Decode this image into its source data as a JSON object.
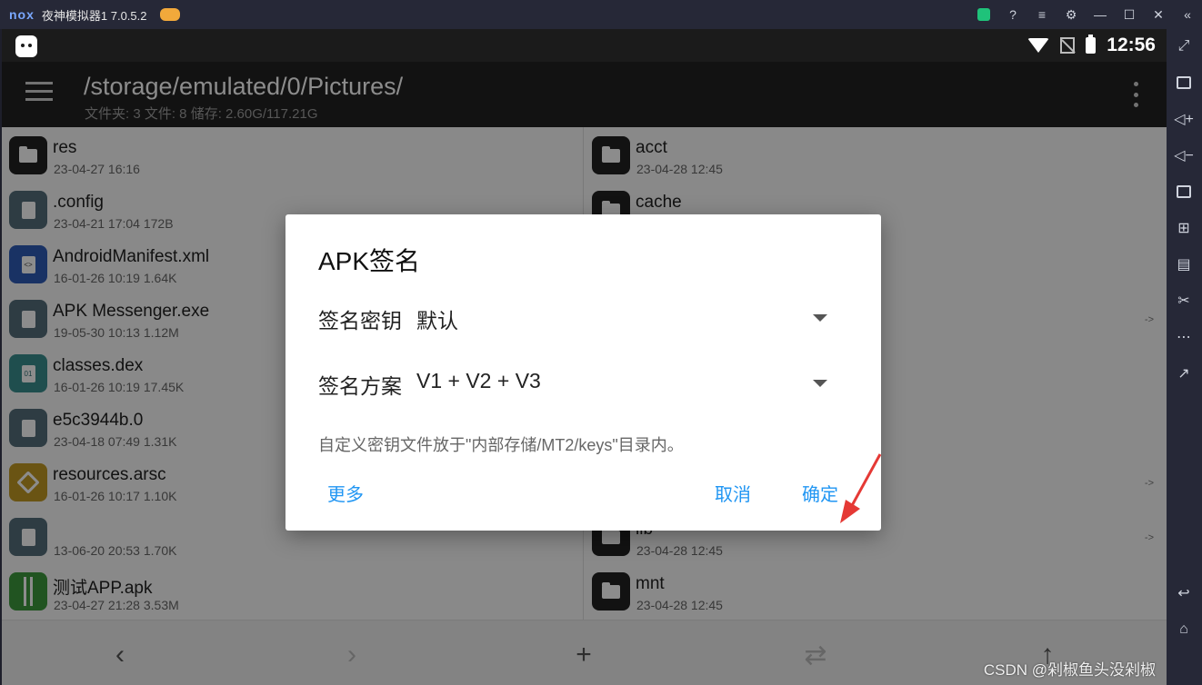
{
  "emulator": {
    "logo": "nox",
    "title": "夜神模拟器1 7.0.5.2"
  },
  "statusbar": {
    "time": "12:56"
  },
  "toolbar": {
    "path": "/storage/emulated/0/Pictures/",
    "info": "文件夹: 3  文件: 8  储存: 2.60G/117.21G"
  },
  "left_files": [
    {
      "name": "res",
      "meta": "23-04-27 16:16",
      "icon": "folder-icon",
      "color": "#212121"
    },
    {
      "name": ".config",
      "meta": "23-04-21 17:04  172B",
      "icon": "file-icon",
      "color": "#546e7a"
    },
    {
      "name": "AndroidManifest.xml",
      "meta": "16-01-26 10:19  1.64K",
      "icon": "xml-file-icon",
      "color": "#2f5bb7"
    },
    {
      "name": "APK Messenger.exe",
      "meta": "19-05-30 10:13  1.12M",
      "icon": "file-icon",
      "color": "#546e7a"
    },
    {
      "name": "classes.dex",
      "meta": "16-01-26 10:19  17.45K",
      "icon": "dex-file-icon",
      "color": "#3a8f8f"
    },
    {
      "name": "e5c3944b.0",
      "meta": "23-04-18 07:49  1.31K",
      "icon": "file-icon",
      "color": "#546e7a"
    },
    {
      "name": "resources.arsc",
      "meta": "16-01-26 10:17  1.10K",
      "icon": "layers-icon",
      "color": "#c29a24"
    },
    {
      "name": "",
      "meta": "13-06-20 20:53  1.70K",
      "icon": "file-icon",
      "color": "#546e7a"
    },
    {
      "name": "测试APP.apk",
      "meta": "23-04-27 21:28  3.53M",
      "icon": "apk-icon",
      "color": "#3c9a3c"
    }
  ],
  "right_files": [
    {
      "name": "acct",
      "meta": "23-04-28 12:45"
    },
    {
      "name": "cache",
      "meta": ""
    },
    {
      "name": "",
      "meta": ""
    },
    {
      "name": "",
      "meta": "",
      "arrow": "->"
    },
    {
      "name": "",
      "meta": ""
    },
    {
      "name": "",
      "meta": ""
    },
    {
      "name": "",
      "meta": "",
      "arrow": "->"
    },
    {
      "name": "lib",
      "meta": "23-04-28 12:45",
      "arrow": "->"
    },
    {
      "name": "mnt",
      "meta": "23-04-28 12:45"
    }
  ],
  "dialog": {
    "title": "APK签名",
    "key_label": "签名密钥",
    "key_value": "默认",
    "scheme_label": "签名方案",
    "scheme_value": "V1 + V2 + V3",
    "hint": "自定义密钥文件放于\"内部存储/MT2/keys\"目录内。",
    "more": "更多",
    "cancel": "取消",
    "confirm": "确定"
  },
  "bottombar": {
    "back": "‹",
    "forward": "›",
    "add": "+",
    "swap": "⇄",
    "up": "↑"
  },
  "watermark": "CSDN @剁椒鱼头没剁椒",
  "colors": {
    "accent": "#2196f3",
    "toolbar": "#212121",
    "arrow": "#e53935"
  }
}
